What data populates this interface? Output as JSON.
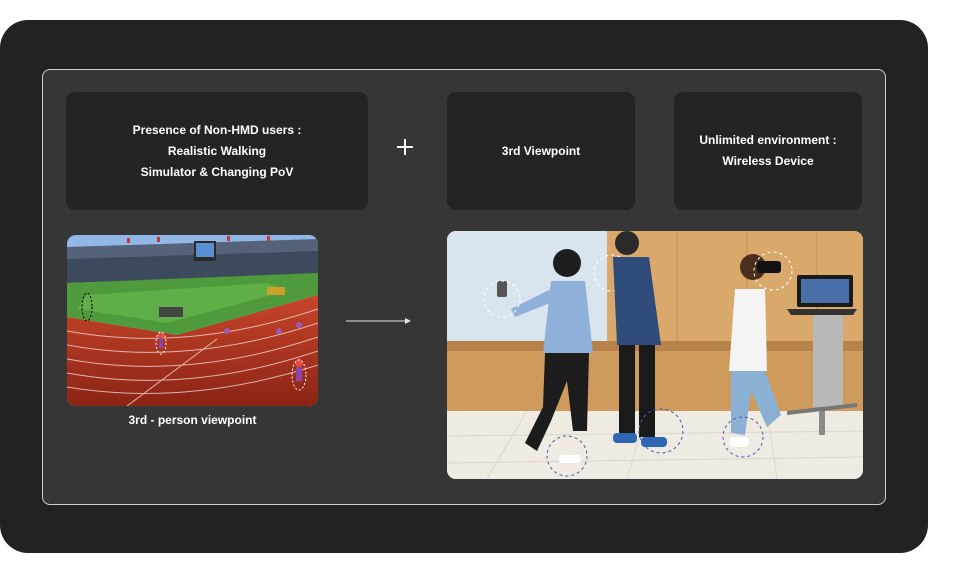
{
  "cards": {
    "presence": {
      "line1": "Presence of Non-HMD users :",
      "line2": "Realistic Walking",
      "line3": "Simulator & Changing PoV"
    },
    "viewpoint": {
      "line1": "3rd Viewpoint"
    },
    "wireless": {
      "line1": "Unlimited environment :",
      "line2": "Wireless Device"
    }
  },
  "images": {
    "vr_scene": {
      "caption": "3rd - person viewpoint",
      "icon": "stadium-track-render"
    },
    "photo_scene": {
      "icon": "people-walking-photo"
    }
  },
  "icons": {
    "plus": "plus-icon",
    "arrow": "arrow-right-icon"
  },
  "colors": {
    "outer_bg": "#222222",
    "panel_bg": "#363636",
    "card_bg": "#242424",
    "text": "#ffffff"
  }
}
